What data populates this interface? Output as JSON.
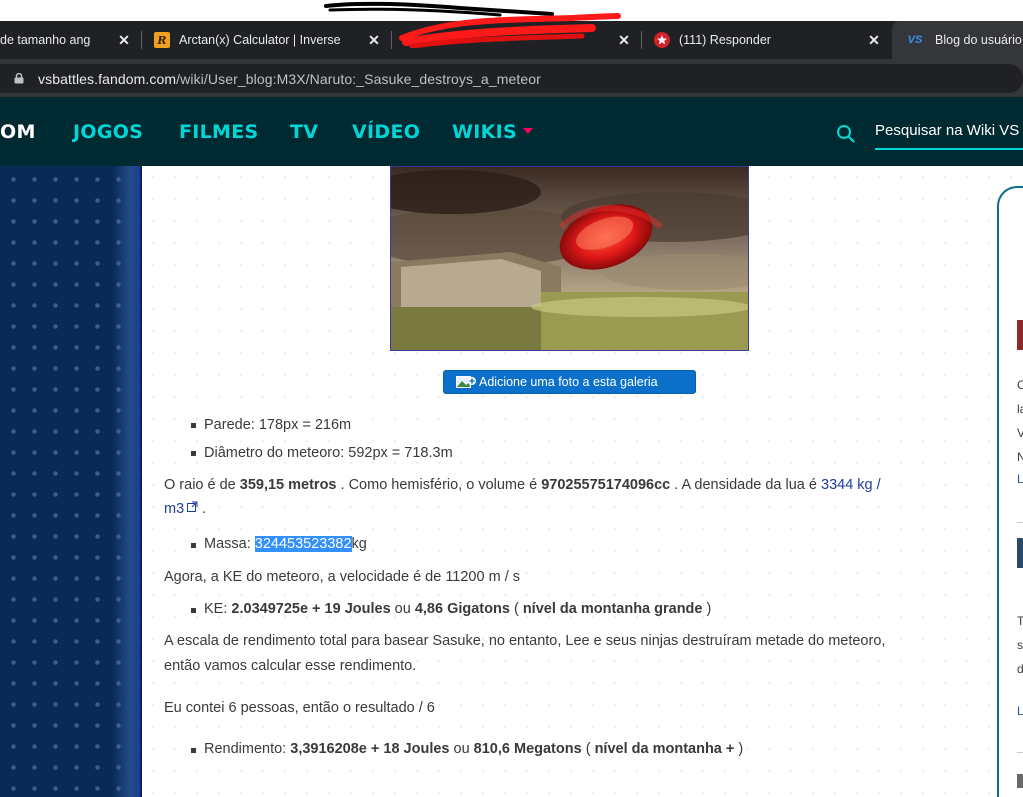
{
  "browser": {
    "tabs": [
      {
        "title": "de tamanho ang",
        "favicon": "none"
      },
      {
        "title": "Arctan(x) Calculator | Inverse",
        "favicon": "R"
      },
      {
        "title": "",
        "favicon": "redacted"
      },
      {
        "title": "(111) Responder",
        "favicon": "red-star"
      },
      {
        "title": "Blog do usuário",
        "favicon": "VS"
      }
    ],
    "tab_close_glyph": "✕",
    "url_host": "vsbattles.fandom.com",
    "url_path": "/wiki/User_blog:M3X/Naruto:_Sasuke_destroys_a_meteor"
  },
  "nav": {
    "logo_fragment": "OM",
    "items": [
      "JOGOS",
      "FILMES",
      "TV",
      "VÍDEO",
      "WIKIS"
    ],
    "search_placeholder": "Pesquisar na Wiki VS"
  },
  "article": {
    "add_photo_label": "Adicione uma foto a esta galeria",
    "bullet_wall": "Parede: 178px = 216m",
    "bullet_diameter": "Diâmetro do meteoro: 592px = 718.3m",
    "radius_p1": "O raio é de ",
    "radius_value": "359,15 metros",
    "radius_p2": " . Como hemisfério, o volume é ",
    "volume_value": "97025575174096cc",
    "radius_p3": " . A densidade da lua é ",
    "density_link_1": "3344 kg /",
    "density_link_2": "m3",
    "period": " .",
    "mass_label": "Massa: ",
    "mass_selected": "324453523382",
    "mass_unit": "kg",
    "velocity_line": "Agora, a KE do meteoro, a velocidade é de 11200 m / s",
    "ke_label": "KE: ",
    "ke_joules": "2.0349725e + 19 Joules",
    "ke_or": " ou ",
    "ke_gigatons": "4,86 Gigatons",
    "ke_paren_open": " ( ",
    "ke_tier": "nível da montanha grande",
    "ke_paren_close": " )",
    "scale_line_1": "A escala de rendimento total para basear Sasuke, no entanto, Lee e seus ninjas destruíram metade do meteoro,",
    "scale_line_2": "então vamos calcular esse rendimento.",
    "people_line": "Eu contei 6 pessoas, então o resultado / 6",
    "yield_label": "Rendimento: ",
    "yield_joules": "3,3916208e + 18 Joules",
    "yield_or": " ou ",
    "yield_megatons": "810,6 Megatons",
    "yield_paren_open": " ( ",
    "yield_tier": "nível da montanha +",
    "yield_paren_close": " )"
  },
  "rail_fragments": {
    "letters": [
      "C",
      "la",
      "V",
      "N",
      "L",
      "T",
      "s",
      "d",
      "L"
    ]
  },
  "colors": {
    "tab_strip": "#202124",
    "active_tab": "#35363a",
    "fandom_nav": "#002a32",
    "nav_link": "#00d6d6",
    "nav_caret": "#fa005a",
    "button_blue": "#0b70c9",
    "selection": "#3390ff",
    "link": "#1e3e9a"
  }
}
